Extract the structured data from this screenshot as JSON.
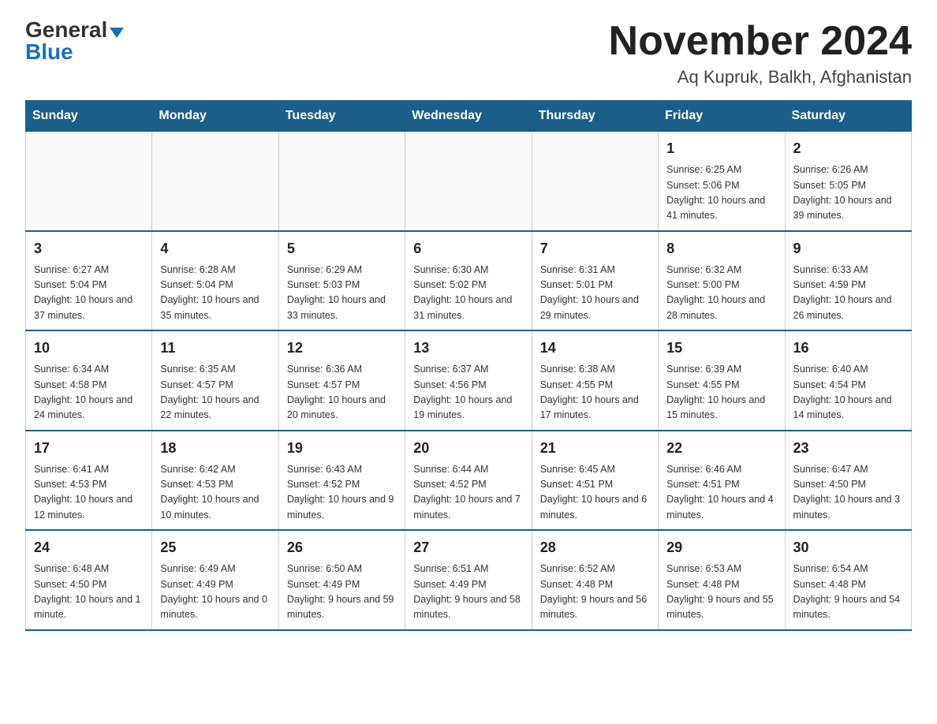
{
  "logo": {
    "general": "General",
    "blue": "Blue"
  },
  "title": "November 2024",
  "location": "Aq Kupruk, Balkh, Afghanistan",
  "days_of_week": [
    "Sunday",
    "Monday",
    "Tuesday",
    "Wednesday",
    "Thursday",
    "Friday",
    "Saturday"
  ],
  "weeks": [
    [
      {
        "day": "",
        "info": ""
      },
      {
        "day": "",
        "info": ""
      },
      {
        "day": "",
        "info": ""
      },
      {
        "day": "",
        "info": ""
      },
      {
        "day": "",
        "info": ""
      },
      {
        "day": "1",
        "info": "Sunrise: 6:25 AM\nSunset: 5:06 PM\nDaylight: 10 hours and 41 minutes."
      },
      {
        "day": "2",
        "info": "Sunrise: 6:26 AM\nSunset: 5:05 PM\nDaylight: 10 hours and 39 minutes."
      }
    ],
    [
      {
        "day": "3",
        "info": "Sunrise: 6:27 AM\nSunset: 5:04 PM\nDaylight: 10 hours and 37 minutes."
      },
      {
        "day": "4",
        "info": "Sunrise: 6:28 AM\nSunset: 5:04 PM\nDaylight: 10 hours and 35 minutes."
      },
      {
        "day": "5",
        "info": "Sunrise: 6:29 AM\nSunset: 5:03 PM\nDaylight: 10 hours and 33 minutes."
      },
      {
        "day": "6",
        "info": "Sunrise: 6:30 AM\nSunset: 5:02 PM\nDaylight: 10 hours and 31 minutes."
      },
      {
        "day": "7",
        "info": "Sunrise: 6:31 AM\nSunset: 5:01 PM\nDaylight: 10 hours and 29 minutes."
      },
      {
        "day": "8",
        "info": "Sunrise: 6:32 AM\nSunset: 5:00 PM\nDaylight: 10 hours and 28 minutes."
      },
      {
        "day": "9",
        "info": "Sunrise: 6:33 AM\nSunset: 4:59 PM\nDaylight: 10 hours and 26 minutes."
      }
    ],
    [
      {
        "day": "10",
        "info": "Sunrise: 6:34 AM\nSunset: 4:58 PM\nDaylight: 10 hours and 24 minutes."
      },
      {
        "day": "11",
        "info": "Sunrise: 6:35 AM\nSunset: 4:57 PM\nDaylight: 10 hours and 22 minutes."
      },
      {
        "day": "12",
        "info": "Sunrise: 6:36 AM\nSunset: 4:57 PM\nDaylight: 10 hours and 20 minutes."
      },
      {
        "day": "13",
        "info": "Sunrise: 6:37 AM\nSunset: 4:56 PM\nDaylight: 10 hours and 19 minutes."
      },
      {
        "day": "14",
        "info": "Sunrise: 6:38 AM\nSunset: 4:55 PM\nDaylight: 10 hours and 17 minutes."
      },
      {
        "day": "15",
        "info": "Sunrise: 6:39 AM\nSunset: 4:55 PM\nDaylight: 10 hours and 15 minutes."
      },
      {
        "day": "16",
        "info": "Sunrise: 6:40 AM\nSunset: 4:54 PM\nDaylight: 10 hours and 14 minutes."
      }
    ],
    [
      {
        "day": "17",
        "info": "Sunrise: 6:41 AM\nSunset: 4:53 PM\nDaylight: 10 hours and 12 minutes."
      },
      {
        "day": "18",
        "info": "Sunrise: 6:42 AM\nSunset: 4:53 PM\nDaylight: 10 hours and 10 minutes."
      },
      {
        "day": "19",
        "info": "Sunrise: 6:43 AM\nSunset: 4:52 PM\nDaylight: 10 hours and 9 minutes."
      },
      {
        "day": "20",
        "info": "Sunrise: 6:44 AM\nSunset: 4:52 PM\nDaylight: 10 hours and 7 minutes."
      },
      {
        "day": "21",
        "info": "Sunrise: 6:45 AM\nSunset: 4:51 PM\nDaylight: 10 hours and 6 minutes."
      },
      {
        "day": "22",
        "info": "Sunrise: 6:46 AM\nSunset: 4:51 PM\nDaylight: 10 hours and 4 minutes."
      },
      {
        "day": "23",
        "info": "Sunrise: 6:47 AM\nSunset: 4:50 PM\nDaylight: 10 hours and 3 minutes."
      }
    ],
    [
      {
        "day": "24",
        "info": "Sunrise: 6:48 AM\nSunset: 4:50 PM\nDaylight: 10 hours and 1 minute."
      },
      {
        "day": "25",
        "info": "Sunrise: 6:49 AM\nSunset: 4:49 PM\nDaylight: 10 hours and 0 minutes."
      },
      {
        "day": "26",
        "info": "Sunrise: 6:50 AM\nSunset: 4:49 PM\nDaylight: 9 hours and 59 minutes."
      },
      {
        "day": "27",
        "info": "Sunrise: 6:51 AM\nSunset: 4:49 PM\nDaylight: 9 hours and 58 minutes."
      },
      {
        "day": "28",
        "info": "Sunrise: 6:52 AM\nSunset: 4:48 PM\nDaylight: 9 hours and 56 minutes."
      },
      {
        "day": "29",
        "info": "Sunrise: 6:53 AM\nSunset: 4:48 PM\nDaylight: 9 hours and 55 minutes."
      },
      {
        "day": "30",
        "info": "Sunrise: 6:54 AM\nSunset: 4:48 PM\nDaylight: 9 hours and 54 minutes."
      }
    ]
  ]
}
